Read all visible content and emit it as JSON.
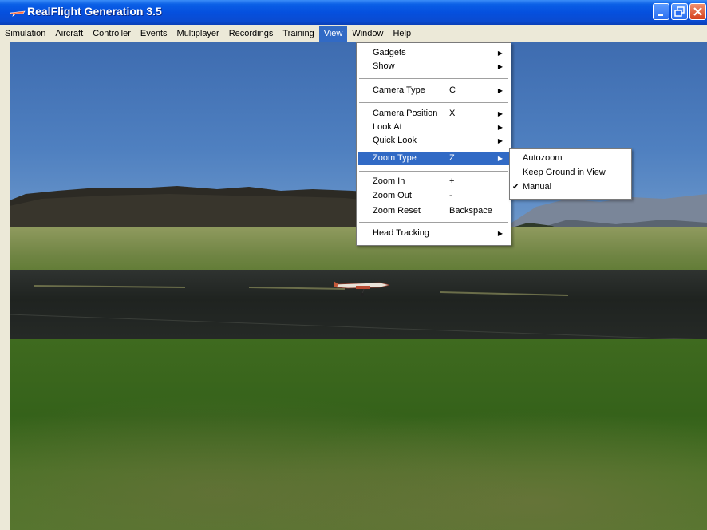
{
  "window": {
    "title": "RealFlight Generation 3.5"
  },
  "menubar": {
    "items": [
      "Simulation",
      "Aircraft",
      "Controller",
      "Events",
      "Multiplayer",
      "Recordings",
      "Training",
      "View",
      "Window",
      "Help"
    ],
    "active": "View"
  },
  "view_menu": {
    "gadgets": "Gadgets",
    "show": "Show",
    "camera_type": "Camera Type",
    "camera_type_key": "C",
    "camera_position": "Camera Position",
    "camera_position_key": "X",
    "look_at": "Look At",
    "quick_look": "Quick Look",
    "zoom_type": "Zoom Type",
    "zoom_type_key": "Z",
    "zoom_in": "Zoom In",
    "zoom_in_key": "+",
    "zoom_out": "Zoom Out",
    "zoom_out_key": "-",
    "zoom_reset": "Zoom Reset",
    "zoom_reset_key": "Backspace",
    "head_tracking": "Head Tracking"
  },
  "zoom_submenu": {
    "autozoom": "Autozoom",
    "keep_ground": "Keep Ground in View",
    "manual": "Manual",
    "checked": "Manual"
  },
  "colors": {
    "menu_highlight": "#316ac5",
    "title_bar": "#0550de",
    "menu_bar": "#ece9d8"
  }
}
